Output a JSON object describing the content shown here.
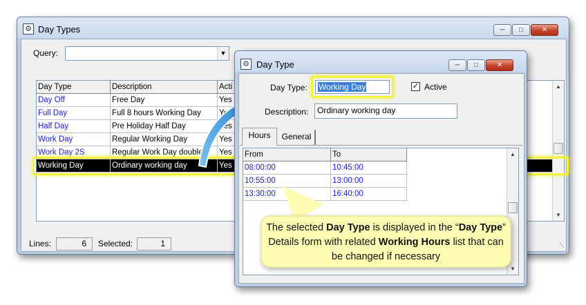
{
  "day_types_window": {
    "title": "Day Types",
    "icon": "gear-window-icon",
    "query_label": "Query:",
    "query_value": "",
    "columns": [
      "Day Type",
      "Description",
      "Acti"
    ],
    "rows": [
      {
        "day_type": "Day Off",
        "description": "Free Day",
        "active": "Yes"
      },
      {
        "day_type": "Full Day",
        "description": "Full 8 hours Working Day",
        "active": "Yes"
      },
      {
        "day_type": "Half Day",
        "description": "Pre Holiday Half Day",
        "active": "Yes"
      },
      {
        "day_type": "Work Day",
        "description": "Regular Working Day",
        "active": "Yes"
      },
      {
        "day_type": "Work Day 2S",
        "description": "Regular Work Day double",
        "active": "Yes"
      },
      {
        "day_type": "Working Day",
        "description": "Ordinary working day",
        "active": "Yes"
      }
    ],
    "selected_row_index": 5,
    "status": {
      "lines_label": "Lines:",
      "lines_value": "6",
      "selected_label": "Selected:",
      "selected_value": "1"
    }
  },
  "day_type_dialog": {
    "title": "Day Type",
    "icon": "gear-window-icon",
    "day_type_label": "Day Type:",
    "day_type_value": "Working Day",
    "active_label": "Active",
    "active_checked": true,
    "description_label": "Description:",
    "description_value": "Ordinary working day",
    "tabs": [
      {
        "label": "Hours",
        "active": true
      },
      {
        "label": "General",
        "active": false
      }
    ],
    "hours_columns": [
      "From",
      "To"
    ],
    "hours_rows": [
      {
        "from": "08:00:00",
        "to": "10:45:00"
      },
      {
        "from": "10:55:00",
        "to": "13:00:00"
      },
      {
        "from": "13:30:00",
        "to": "16:40:00"
      }
    ]
  },
  "callout": {
    "part1": "The selected ",
    "bold1": "Day Type",
    "part2": " is displayed in the “",
    "bold2": "Day Type",
    "part3": "” Details form with related ",
    "bold3": "Working Hours",
    "part4": " list that can be changed if necessary"
  },
  "colors": {
    "link_blue": "#1a1ae0",
    "highlight_yellow": "#f2f23a",
    "callout_bg": "#fefdb3",
    "arrow_blue": "#3a9be0"
  }
}
